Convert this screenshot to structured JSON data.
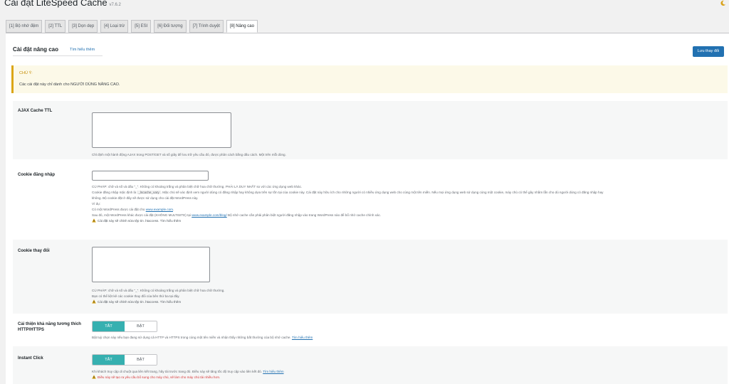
{
  "header": {
    "title": "Cài đặt LiteSpeed Cache",
    "version": "v7.6.2"
  },
  "tabs": [
    {
      "label": "[1] Bộ nhớ đệm"
    },
    {
      "label": "[2] TTL"
    },
    {
      "label": "[3] Dọn dẹp"
    },
    {
      "label": "[4] Loại trừ"
    },
    {
      "label": "[5] ESI"
    },
    {
      "label": "[6] Đối tượng"
    },
    {
      "label": "[7] Trình duyệt"
    },
    {
      "label": "[8] Nâng cao"
    }
  ],
  "section": {
    "title": "Cài đặt nâng cao",
    "learn_more": "Tìm hiểu thêm",
    "save_label": "Lưu thay đổi"
  },
  "notice": {
    "title": "CHÚ Ý:",
    "text": "Các cài đặt này chỉ dành cho NGƯỜI DÙNG NÂNG CAO."
  },
  "ajax": {
    "label": "AJAX Cache TTL",
    "desc": "Chỉ định một hành động AJAX trong POST/GET và số giây để lưu trữ yêu cầu đó, được phân cách bằng dấu cách. Một trên mỗi dòng."
  },
  "login_cookie": {
    "label": "Cookie đăng nhập",
    "line1": "CÚ PHÁP: chữ và số và dấu \"_\". Không có khoảng trắng và phân biệt chữ hoa chữ thường. PHẢI LÀ DUY NHẤT so với các ứng dụng web khác.",
    "line2_pre": "Cookie đăng nhập mặc định là",
    "line2_code": "_lscache_vary",
    "line2_post": ". Mặc chủ sẽ xác định xem người dùng có đăng nhập hay không dựa trên sự tồn tại của cookie này. Cài đặt này hữu ích cho những người có nhiều ứng dụng web cho cùng một tên miền. Nếu mọi ứng dụng web sử dụng cùng một cookie, máy chủ có thể gây nhầm lẫn cho dù người dùng có đăng nhập hay",
    "line3": "không. Bộ cookie đặt ở đây sẽ được sử dụng cho cài đặt WordPress này.",
    "line4": "Ví dụ:",
    "line5_pre": "Có một WordPress được cài đặt cho",
    "line5_link": "www.example.com",
    "line5_post": ".",
    "line6_pre": "Sau đó, một WordPress khác được cài đặt (KHÔNG MULTISITE) tại",
    "line6_link": "www.example.com/blog/",
    "line6_post": " Bộ nhớ cache cần phải phân biệt người đăng nhập vào trang WordPress nào để bổ nhớ cache chính xác.",
    "warn_text": "Cài đặt này sẽ chỉnh sửa tệp tin .htaccess.",
    "warn_link": "Tìm hiểu thêm"
  },
  "vary_cookie": {
    "label": "Cookie thay đổi",
    "line1": "CÚ PHÁP: chữ và số và dấu \"_\". Không có khoảng trắng và phân biệt chữ hoa chữ thường.",
    "line2": "Bạn có thể liệt kê các cookie thay đổi của bên thứ ba tại đây.",
    "warn_text": "Cài đặt này sẽ chỉnh sửa tệp tin .htaccess.",
    "warn_link": "Tìm hiểu thêm"
  },
  "http_compat": {
    "label_line1": "Cải thiện khả năng tương thích",
    "label_line2": "HTTP/HTTPS",
    "on": "TẮT",
    "off": "BẬT",
    "desc_pre": "Bật tuỳ chọn này nếu bạn đang sử dụng cả HTTP và HTTPS trong cùng một tên miền và nhận thấy những bất thường của bộ nhớ cache.",
    "desc_link": "Tìm hiểu thêm"
  },
  "instant_click": {
    "label": "Instant Click",
    "on": "TẮT",
    "off": "BẬT",
    "desc_pre": "Khi khách truy cập di chuột qua liên kết trang, hãy tải trước trang đó. Điều này sẽ tăng tốc độ truy cập vào liên kết đó.",
    "desc_link": "Tìm hiểu thêm",
    "warn_text": "Điều này sẽ tạo ra yêu cầu bổ sung cho máy chủ, sẽ làm cho máy chủ tải nhiều hơn."
  },
  "colors": {
    "accent": "#2271b1",
    "toggle_active": "#36b0b0",
    "warning": "#dba617",
    "danger": "#d63638"
  }
}
